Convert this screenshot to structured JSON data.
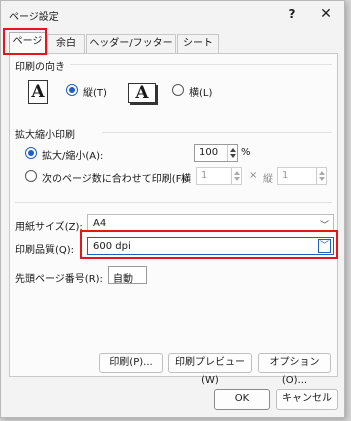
{
  "window": {
    "title": "ページ設定",
    "help_label": "?",
    "close_label": "✕"
  },
  "tabs": [
    {
      "label": "ページ",
      "active": true
    },
    {
      "label": "余白",
      "active": false
    },
    {
      "label": "ヘッダー/フッター",
      "active": false
    },
    {
      "label": "シート",
      "active": false
    }
  ],
  "orientation": {
    "heading": "印刷の向き",
    "portrait_label": "縦(T)",
    "landscape_label": "横(L)",
    "portrait_icon": "A",
    "landscape_icon": "A",
    "selected": "portrait"
  },
  "scaling": {
    "heading": "拡大縮小印刷",
    "zoom_label": "拡大/縮小(A):",
    "zoom_value": "100",
    "zoom_unit": "%",
    "fit_label": "次のページ数に合わせて印刷(F):",
    "fit_wide_label": "横",
    "fit_wide_value": "1",
    "times": "×",
    "fit_tall_label": "縦",
    "fit_tall_value": "1",
    "selected": "zoom"
  },
  "paper": {
    "label": "用紙サイズ(Z):",
    "value": "A4"
  },
  "quality": {
    "label": "印刷品質(Q):",
    "value": "600 dpi"
  },
  "first_page": {
    "label": "先頭ページ番号(R):",
    "value": "自動"
  },
  "buttons": {
    "print": "印刷(P)...",
    "preview": "印刷プレビュー(W)",
    "options": "オプション(O)...",
    "ok": "OK",
    "cancel": "キャンセル"
  },
  "colors": {
    "highlight": "#e4151c",
    "accent": "#1f5fbf"
  }
}
